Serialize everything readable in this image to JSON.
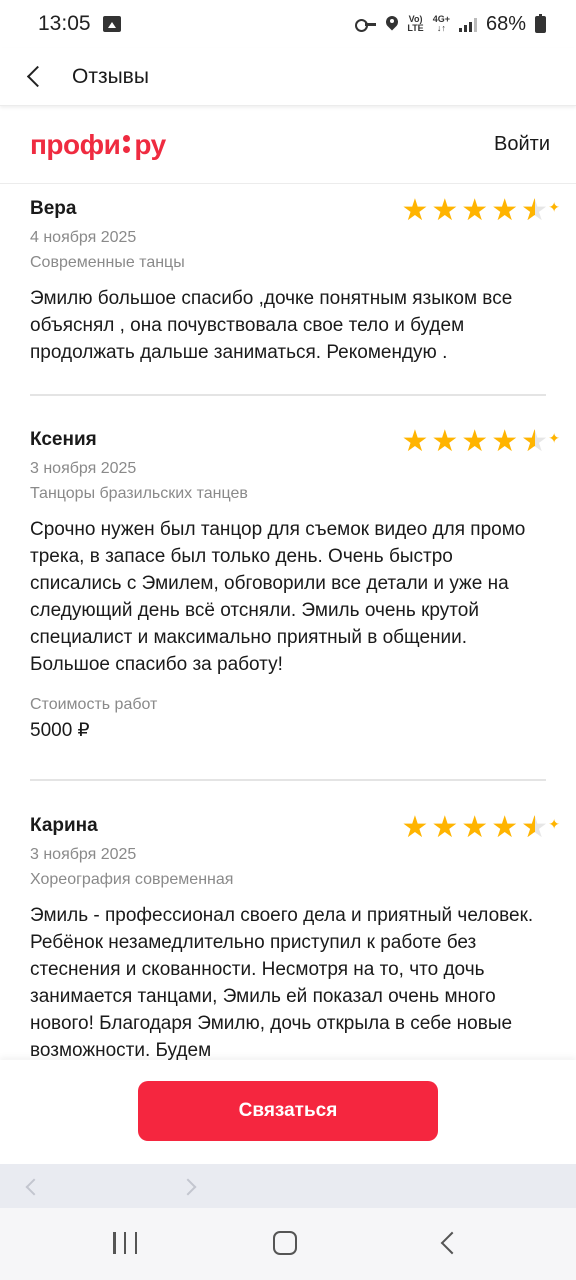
{
  "status_bar": {
    "time": "13:05",
    "volte": "Vo) LTE",
    "network": "4G+",
    "battery": "68%"
  },
  "header": {
    "title": "Отзывы"
  },
  "brand": {
    "logo_part1": "профи",
    "logo_part2": "ру",
    "login_label": "Войти",
    "color": "#ef2b40"
  },
  "reviews": [
    {
      "name": "Вера",
      "rating": 4.5,
      "date": "4 ноября 2025",
      "category": "Современные танцы",
      "text": "Эмилю большое спасибо ,дочке понятным языком все объяснял , она почувствовала свое тело и будем продолжать дальше заниматься. Рекомендую ."
    },
    {
      "name": "Ксения",
      "rating": 4.5,
      "date": "3 ноября 2025",
      "category": "Танцоры бразильских танцев",
      "text": "Срочно нужен был танцор для съемок видео для промо трека, в запасе был только день. Очень быстро списались с Эмилем, обговорили все детали и уже на следующий день всё отсняли. Эмиль очень крутой специалист и максимально приятный в общении. Большое спасибо за работу!",
      "cost_label": "Стоимость работ",
      "cost_value": "5000 ₽"
    },
    {
      "name": "Карина",
      "rating": 4.5,
      "date": "3 ноября 2025",
      "category": "Хореография современная",
      "text": "Эмиль - профессионал своего дела и приятный человек. Ребёнок незамедлительно приступил к работе без стеснения и скованности. Несмотря на то, что дочь занимается танцами, Эмиль ей показал очень много нового! Благодаря Эмилю, дочь открыла в себе новые возможности. Будем"
    }
  ],
  "action": {
    "contact_label": "Связаться",
    "color": "#f5263f"
  },
  "icons": {
    "star_color": "#ffb400"
  }
}
